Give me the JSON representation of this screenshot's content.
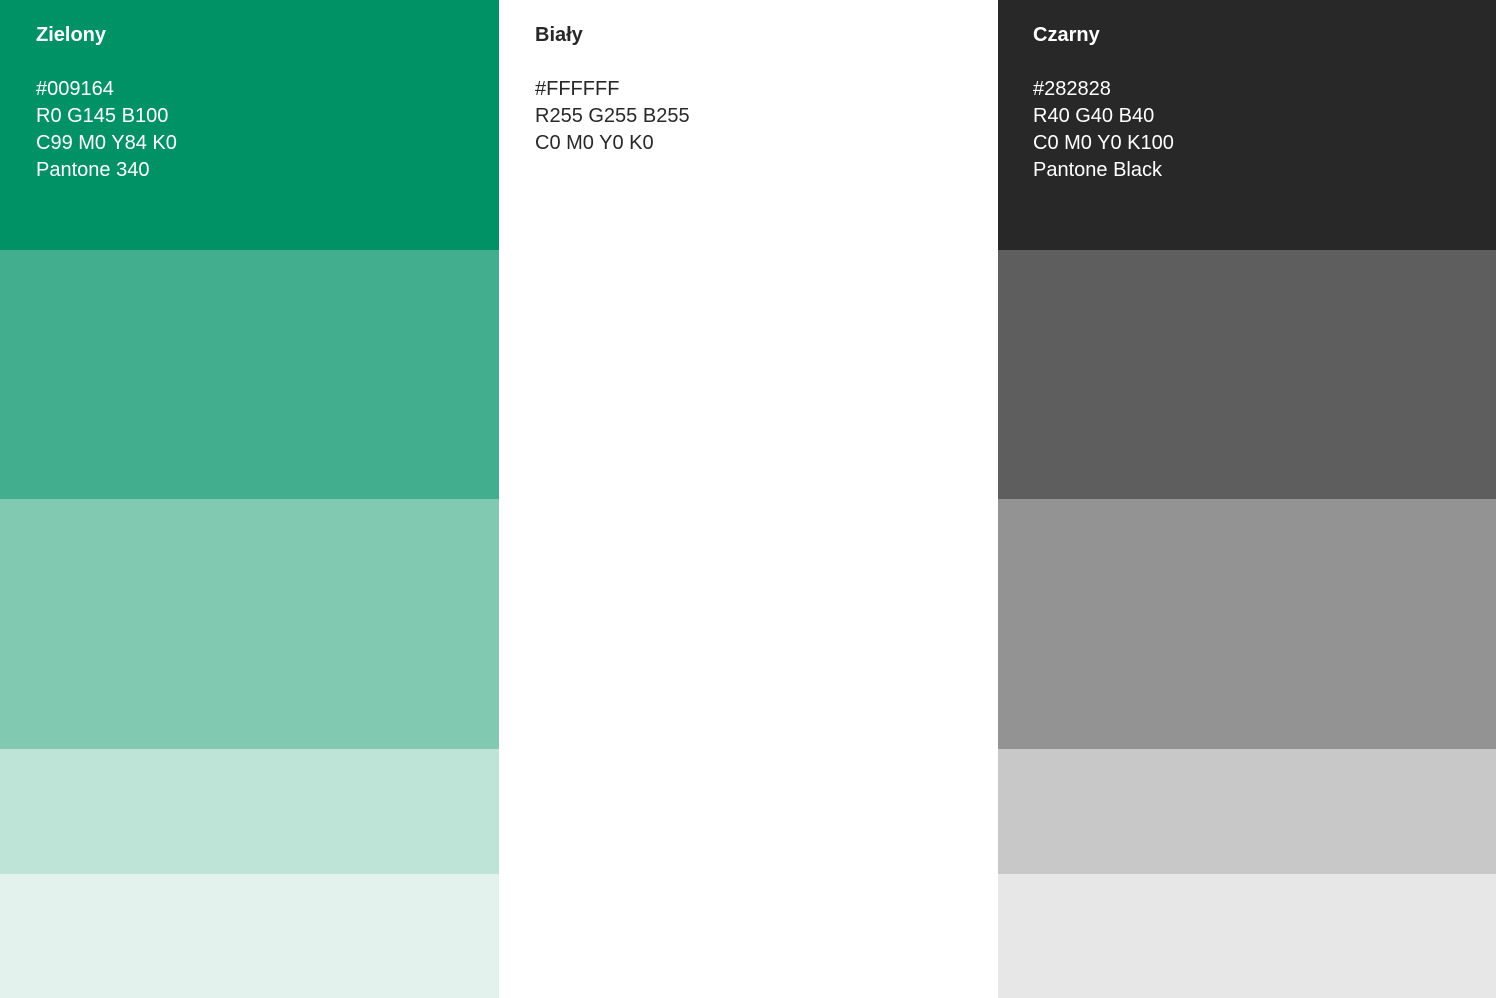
{
  "palette": [
    {
      "name": "Zielony",
      "hex": "#009164",
      "rgb": "R0 G145 B100",
      "cmyk": "C99 M0 Y84 K0",
      "pantone": "Pantone 340",
      "swatches": [
        "#009164",
        "#43ae8d",
        "#82c9b1",
        "#bee3d7",
        "#e4f2ed"
      ]
    },
    {
      "name": "Biały",
      "hex": "#FFFFFF",
      "rgb": "R255 G255 B255",
      "cmyk": "C0 M0 Y0 K0",
      "swatches": [
        "#ffffff"
      ]
    },
    {
      "name": "Czarny",
      "hex": "#282828",
      "rgb": "R40 G40 B40",
      "cmyk": "C0 M0 Y0 K100",
      "pantone": "Pantone Black",
      "swatches": [
        "#282828",
        "#5e5e5e",
        "#939393",
        "#c8c8c8",
        "#e7e7e7"
      ]
    }
  ]
}
